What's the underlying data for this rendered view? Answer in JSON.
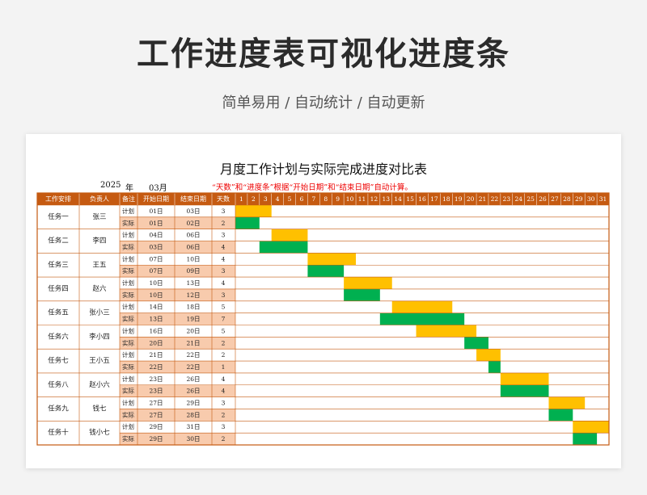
{
  "banner": {
    "title": "工作进度表可视化进度条",
    "subtitle": "简单易用  /  自动统计  /  自动更新"
  },
  "sheet": {
    "title": "月度工作计划与实际完成进度对比表",
    "year": "2025",
    "year_unit": "年",
    "month": "03月",
    "note": "“天数”和“进度条”根据“开始日期”和“结束日期”自动计算。",
    "headers": [
      "工作安排",
      "负责人",
      "备注",
      "开始日期",
      "结束日期",
      "天数"
    ],
    "days": [
      "1",
      "2",
      "3",
      "4",
      "5",
      "6",
      "7",
      "8",
      "9",
      "10",
      "11",
      "12",
      "13",
      "14",
      "15",
      "16",
      "17",
      "18",
      "19",
      "20",
      "21",
      "22",
      "23",
      "24",
      "25",
      "26",
      "27",
      "28",
      "29",
      "30",
      "31"
    ],
    "plan_label": "计划",
    "actual_label": "实际",
    "colors": {
      "header_fill": "#c55a11",
      "actual_row_fill": "#f8cbad",
      "plan_bar": "#ffc000",
      "actual_bar": "#00b050",
      "border": "#c55a11"
    },
    "tasks": [
      {
        "name": "任务一",
        "owner": "张三",
        "plan": {
          "start": 1,
          "end": 3,
          "start_label": "01日",
          "end_label": "03日",
          "days": "3"
        },
        "actual": {
          "start": 1,
          "end": 2,
          "start_label": "01日",
          "end_label": "02日",
          "days": "2"
        }
      },
      {
        "name": "任务二",
        "owner": "李四",
        "plan": {
          "start": 4,
          "end": 6,
          "start_label": "04日",
          "end_label": "06日",
          "days": "3"
        },
        "actual": {
          "start": 3,
          "end": 6,
          "start_label": "03日",
          "end_label": "06日",
          "days": "4"
        }
      },
      {
        "name": "任务三",
        "owner": "王五",
        "plan": {
          "start": 7,
          "end": 10,
          "start_label": "07日",
          "end_label": "10日",
          "days": "4"
        },
        "actual": {
          "start": 7,
          "end": 9,
          "start_label": "07日",
          "end_label": "09日",
          "days": "3"
        }
      },
      {
        "name": "任务四",
        "owner": "赵六",
        "plan": {
          "start": 10,
          "end": 13,
          "start_label": "10日",
          "end_label": "13日",
          "days": "4"
        },
        "actual": {
          "start": 10,
          "end": 12,
          "start_label": "10日",
          "end_label": "12日",
          "days": "3"
        }
      },
      {
        "name": "任务五",
        "owner": "张小三",
        "plan": {
          "start": 14,
          "end": 18,
          "start_label": "14日",
          "end_label": "18日",
          "days": "5"
        },
        "actual": {
          "start": 13,
          "end": 19,
          "start_label": "13日",
          "end_label": "19日",
          "days": "7"
        }
      },
      {
        "name": "任务六",
        "owner": "李小四",
        "plan": {
          "start": 16,
          "end": 20,
          "start_label": "16日",
          "end_label": "20日",
          "days": "5"
        },
        "actual": {
          "start": 20,
          "end": 21,
          "start_label": "20日",
          "end_label": "21日",
          "days": "2"
        }
      },
      {
        "name": "任务七",
        "owner": "王小五",
        "plan": {
          "start": 21,
          "end": 22,
          "start_label": "21日",
          "end_label": "22日",
          "days": "2"
        },
        "actual": {
          "start": 22,
          "end": 22,
          "start_label": "22日",
          "end_label": "22日",
          "days": "1"
        }
      },
      {
        "name": "任务八",
        "owner": "赵小六",
        "plan": {
          "start": 23,
          "end": 26,
          "start_label": "23日",
          "end_label": "26日",
          "days": "4"
        },
        "actual": {
          "start": 23,
          "end": 26,
          "start_label": "23日",
          "end_label": "26日",
          "days": "4"
        }
      },
      {
        "name": "任务九",
        "owner": "钱七",
        "plan": {
          "start": 27,
          "end": 29,
          "start_label": "27日",
          "end_label": "29日",
          "days": "3"
        },
        "actual": {
          "start": 27,
          "end": 28,
          "start_label": "27日",
          "end_label": "28日",
          "days": "2"
        }
      },
      {
        "name": "任务十",
        "owner": "钱小七",
        "plan": {
          "start": 29,
          "end": 31,
          "start_label": "29日",
          "end_label": "31日",
          "days": "3"
        },
        "actual": {
          "start": 29,
          "end": 30,
          "start_label": "29日",
          "end_label": "30日",
          "days": "2"
        }
      }
    ]
  }
}
